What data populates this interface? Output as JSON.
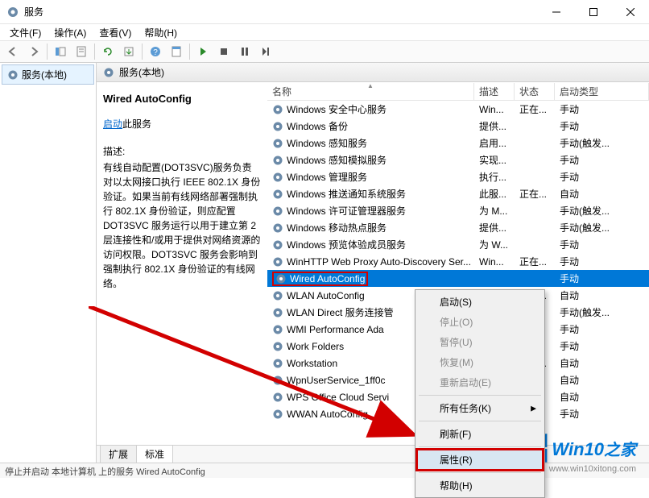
{
  "window": {
    "title": "服务"
  },
  "menu": {
    "file": "文件(F)",
    "action": "操作(A)",
    "view": "查看(V)",
    "help": "帮助(H)"
  },
  "tree": {
    "root": "服务(本地)"
  },
  "panel": {
    "header": "服务(本地)"
  },
  "detail": {
    "name": "Wired AutoConfig",
    "start_link": "启动",
    "start_suffix": "此服务",
    "desc_label": "描述:",
    "desc": "有线自动配置(DOT3SVC)服务负责对以太网接口执行 IEEE 802.1X 身份验证。如果当前有线网络部署强制执行 802.1X 身份验证，则应配置 DOT3SVC 服务运行以用于建立第 2 层连接性和/或用于提供对网络资源的访问权限。DOT3SVC 服务会影响到强制执行 802.1X 身份验证的有线网络。"
  },
  "columns": {
    "name": "名称",
    "desc": "描述",
    "status": "状态",
    "type": "启动类型"
  },
  "services": [
    {
      "name": "Windows 安全中心服务",
      "desc": "Win...",
      "status": "正在...",
      "type": "手动"
    },
    {
      "name": "Windows 备份",
      "desc": "提供...",
      "status": "",
      "type": "手动"
    },
    {
      "name": "Windows 感知服务",
      "desc": "启用...",
      "status": "",
      "type": "手动(触发..."
    },
    {
      "name": "Windows 感知模拟服务",
      "desc": "实现...",
      "status": "",
      "type": "手动"
    },
    {
      "name": "Windows 管理服务",
      "desc": "执行...",
      "status": "",
      "type": "手动"
    },
    {
      "name": "Windows 推送通知系统服务",
      "desc": "此服...",
      "status": "正在...",
      "type": "自动"
    },
    {
      "name": "Windows 许可证管理器服务",
      "desc": "为 M...",
      "status": "",
      "type": "手动(触发..."
    },
    {
      "name": "Windows 移动热点服务",
      "desc": "提供...",
      "status": "",
      "type": "手动(触发..."
    },
    {
      "name": "Windows 预览体验成员服务",
      "desc": "为 W...",
      "status": "",
      "type": "手动"
    },
    {
      "name": "WinHTTP Web Proxy Auto-Discovery Ser...",
      "desc": "Win...",
      "status": "正在...",
      "type": "手动"
    },
    {
      "name": "Wired AutoConfig",
      "desc": "",
      "status": "",
      "type": "手动",
      "selected": true
    },
    {
      "name": "WLAN AutoConfig",
      "desc": "",
      "status": "正在...",
      "type": "自动"
    },
    {
      "name": "WLAN Direct 服务连接管",
      "desc": "",
      "status": "",
      "type": "手动(触发..."
    },
    {
      "name": "WMI Performance Ada",
      "desc": "",
      "status": "",
      "type": "手动"
    },
    {
      "name": "Work Folders",
      "desc": "",
      "status": "",
      "type": "手动"
    },
    {
      "name": "Workstation",
      "desc": "",
      "status": "正在...",
      "type": "自动"
    },
    {
      "name": "WpnUserService_1ff0c",
      "desc": "",
      "status": "",
      "type": "自动"
    },
    {
      "name": "WPS Office Cloud Servi",
      "desc": "",
      "status": "",
      "type": "自动"
    },
    {
      "name": "WWAN AutoConfig",
      "desc": "",
      "status": "",
      "type": "手动"
    }
  ],
  "tabs": {
    "extended": "扩展",
    "standard": "标准"
  },
  "statusbar": "停止并启动 本地计算机 上的服务 Wired AutoConfig",
  "context_menu": {
    "start": "启动(S)",
    "stop": "停止(O)",
    "pause": "暂停(U)",
    "resume": "恢复(M)",
    "restart": "重新启动(E)",
    "all_tasks": "所有任务(K)",
    "refresh": "刷新(F)",
    "properties": "属性(R)",
    "help": "帮助(H)"
  },
  "watermark": {
    "brand_prefix": "Win10",
    "brand_suffix": "之家",
    "url": "www.win10xitong.com"
  }
}
